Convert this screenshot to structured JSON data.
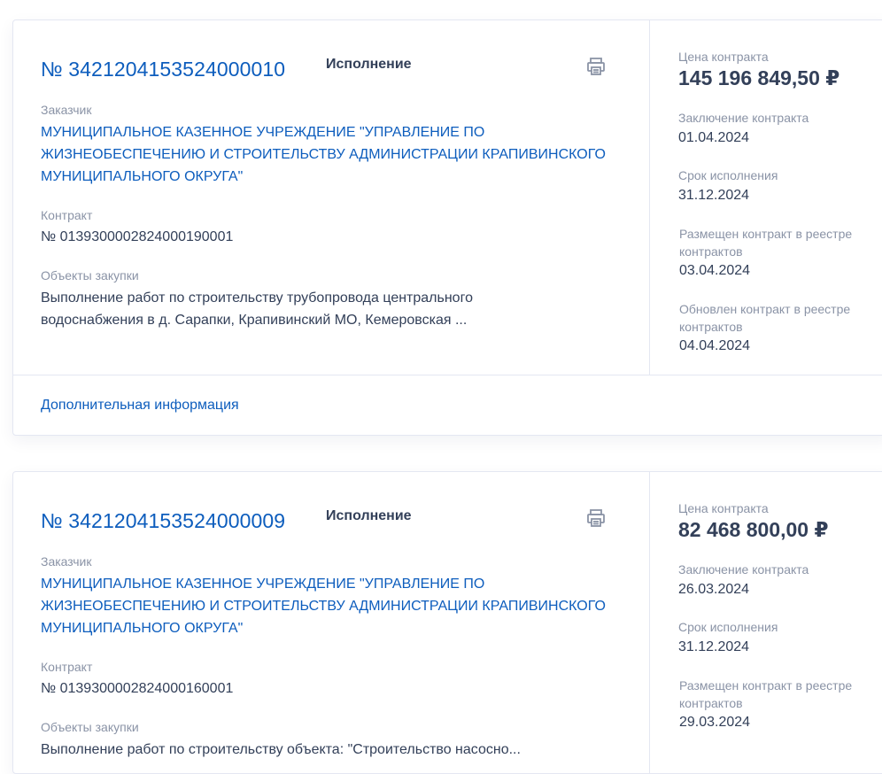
{
  "cards": [
    {
      "number": "№ 3421204153524000010",
      "status": "Исполнение",
      "customer_label": "Заказчик",
      "customer_name": "МУНИЦИПАЛЬНОЕ КАЗЕННОЕ УЧРЕЖДЕНИЕ \"УПРАВЛЕНИЕ ПО ЖИЗНЕОБЕСПЕЧЕНИЮ И СТРОИТЕЛЬСТВУ АДМИНИСТРАЦИИ КРАПИВИНСКОГО МУНИЦИПАЛЬНОГО ОКРУГА\"",
      "contract_label": "Контракт",
      "contract_number": "№ 0139300002824000190001",
      "objects_label": "Объекты закупки",
      "objects_text": "Выполнение работ по строительству трубопровода центрального водоснабжения в д. Сарапки, Крапивинский МО, Кемеровская ...",
      "price_label": "Цена контракта",
      "price_value": "145 196 849,50 ₽",
      "conclusion_label": "Заключение контракта",
      "conclusion_date": "01.04.2024",
      "execution_label": "Срок исполнения",
      "execution_date": "31.12.2024",
      "posted_label": "Размещен контракт в реестре контрактов",
      "posted_date": "03.04.2024",
      "updated_label": "Обновлен контракт в реестре контрактов",
      "updated_date": "04.04.2024",
      "more_info": "Дополнительная информация"
    },
    {
      "number": "№ 3421204153524000009",
      "status": "Исполнение",
      "customer_label": "Заказчик",
      "customer_name": "МУНИЦИПАЛЬНОЕ КАЗЕННОЕ УЧРЕЖДЕНИЕ \"УПРАВЛЕНИЕ ПО ЖИЗНЕОБЕСПЕЧЕНИЮ И СТРОИТЕЛЬСТВУ АДМИНИСТРАЦИИ КРАПИВИНСКОГО МУНИЦИПАЛЬНОГО ОКРУГА\"",
      "contract_label": "Контракт",
      "contract_number": "№ 0139300002824000160001",
      "objects_label": "Объекты закупки",
      "objects_text": "Выполнение работ по строительству объекта: \"Строительство насосно...",
      "price_label": "Цена контракта",
      "price_value": "82 468 800,00 ₽",
      "conclusion_label": "Заключение контракта",
      "conclusion_date": "26.03.2024",
      "execution_label": "Срок исполнения",
      "execution_date": "31.12.2024",
      "posted_label": "Размещен контракт в реестре контрактов",
      "posted_date": "29.03.2024"
    }
  ],
  "icons": {
    "print": "printer-icon"
  },
  "colors": {
    "link": "#0d5dbd",
    "text": "#334059",
    "muted": "#8a93a6",
    "border": "#e4e7f2"
  }
}
